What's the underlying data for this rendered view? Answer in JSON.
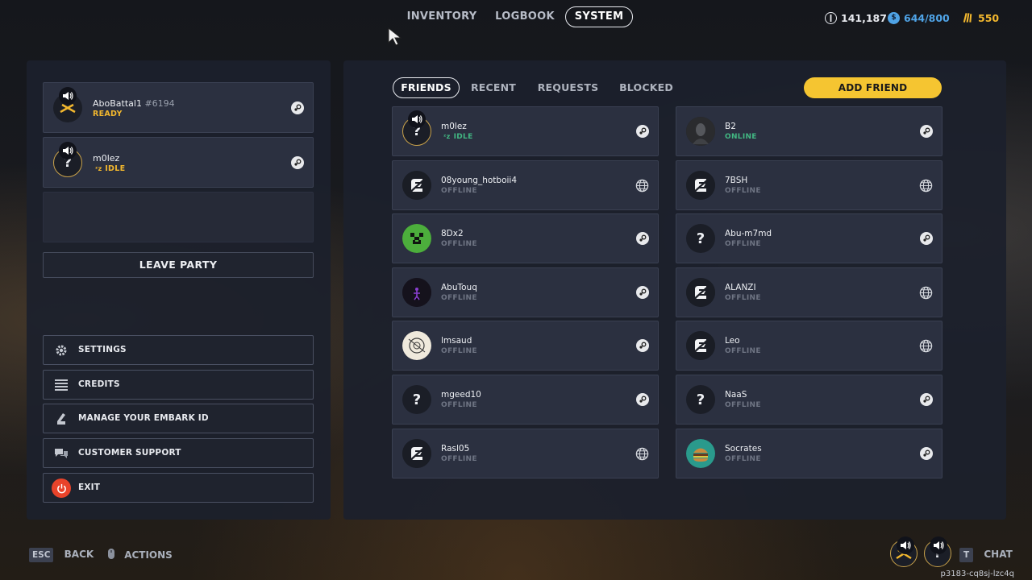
{
  "nav": {
    "tabs": [
      {
        "label": "INVENTORY"
      },
      {
        "label": "LOGBOOK"
      },
      {
        "label": "SYSTEM",
        "active": true
      }
    ]
  },
  "currencies": [
    {
      "icon": "coins-icon",
      "value": "141,187",
      "color": "#e8eaef"
    },
    {
      "icon": "tokens-icon",
      "value": "644/800",
      "color": "#4fa3e6"
    },
    {
      "icon": "gold-icon",
      "value": "550",
      "color": "#f2b72e"
    }
  ],
  "party": {
    "members": [
      {
        "name": "AboBattal1",
        "tag": "#6194",
        "status": "READY",
        "platform": "steam-icon"
      },
      {
        "name": "m0lez",
        "status": "IDLE",
        "platform": "steam-icon"
      }
    ],
    "leave_label": "LEAVE PARTY"
  },
  "menu": {
    "settings": "SETTINGS",
    "credits": "CREDITS",
    "manage_id": "MANAGE YOUR EMBARK ID",
    "support": "CUSTOMER SUPPORT",
    "exit": "EXIT"
  },
  "friends_tabs": {
    "friends": "FRIENDS",
    "recent": "RECENT",
    "requests": "REQUESTS",
    "blocked": "BLOCKED",
    "add_friend": "ADD FRIEND"
  },
  "friends": [
    {
      "name": "m0lez",
      "status": "IDLE",
      "platform": "steam-icon",
      "avatar": "question-gold"
    },
    {
      "name": "B2",
      "status": "ONLINE",
      "platform": "steam-icon",
      "avatar": "photo"
    },
    {
      "name": "08young_hotboii4",
      "status": "OFFLINE",
      "platform": "globe-icon",
      "avatar": "embark"
    },
    {
      "name": "7BSH",
      "status": "OFFLINE",
      "platform": "globe-icon",
      "avatar": "embark"
    },
    {
      "name": "8Dx2",
      "status": "OFFLINE",
      "platform": "steam-icon",
      "avatar": "creeper"
    },
    {
      "name": "Abu-m7md",
      "status": "OFFLINE",
      "platform": "steam-icon",
      "avatar": "question"
    },
    {
      "name": "AbuTouq",
      "status": "OFFLINE",
      "platform": "steam-icon",
      "avatar": "purple"
    },
    {
      "name": "ALANZI",
      "status": "OFFLINE",
      "platform": "globe-icon",
      "avatar": "embark"
    },
    {
      "name": "lmsaud",
      "status": "OFFLINE",
      "platform": "steam-icon",
      "avatar": "sketch"
    },
    {
      "name": "Leo",
      "status": "OFFLINE",
      "platform": "globe-icon",
      "avatar": "embark"
    },
    {
      "name": "mgeed10",
      "status": "OFFLINE",
      "platform": "steam-icon",
      "avatar": "question"
    },
    {
      "name": "NaaS",
      "status": "OFFLINE",
      "platform": "steam-icon",
      "avatar": "question"
    },
    {
      "name": "Rasl05",
      "status": "OFFLINE",
      "platform": "globe-icon",
      "avatar": "embark"
    },
    {
      "name": "Socrates",
      "status": "OFFLINE",
      "platform": "steam-icon",
      "avatar": "burger"
    }
  ],
  "footer": {
    "esc_key": "ESC",
    "back": "BACK",
    "actions": "ACTIONS",
    "chat_key": "T",
    "chat": "CHAT",
    "embark_code": "p3183-cq8sj-lzc4q"
  }
}
